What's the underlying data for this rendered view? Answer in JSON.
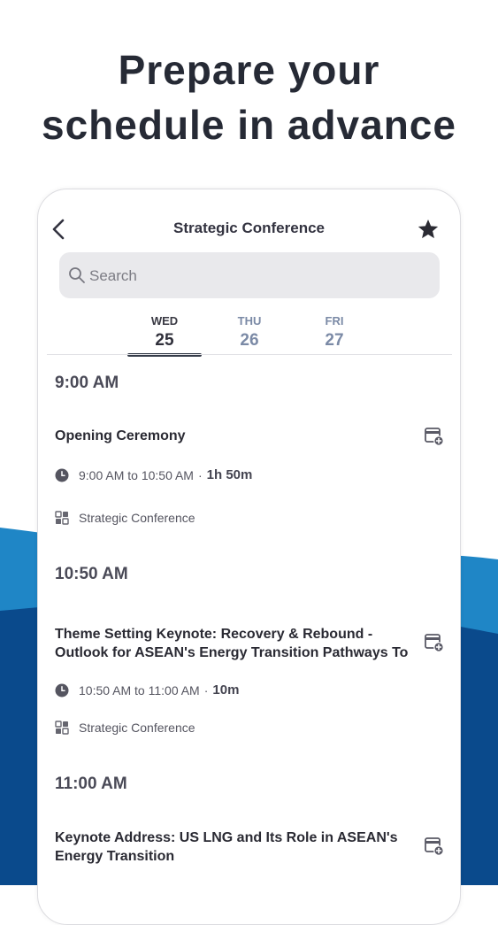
{
  "headline": {
    "line1": "Prepare your",
    "line2": "schedule in advance"
  },
  "colors": {
    "wave_light": "#1f86c6",
    "wave_dark": "#0a4a8c",
    "accent": "#333a47",
    "muted_day": "#7b8aa6"
  },
  "app": {
    "title": "Strategic Conference",
    "back_icon": "chevron-left-icon",
    "favorite_icon": "star-icon",
    "search": {
      "placeholder": "Search",
      "icon": "search-icon"
    },
    "days": [
      {
        "dow": "WED",
        "num": "25",
        "active": true
      },
      {
        "dow": "THU",
        "num": "26",
        "active": false
      },
      {
        "dow": "FRI",
        "num": "27",
        "active": false
      }
    ],
    "groups": [
      {
        "time": "9:00 AM",
        "sessions": [
          {
            "title_lines": [
              "Opening Ceremony"
            ],
            "time_range": "9:00 AM to 10:50 AM",
            "separator": "·",
            "duration": "1h 50m",
            "track": "Strategic Conference"
          }
        ]
      },
      {
        "time": "10:50 AM",
        "sessions": [
          {
            "title_lines": [
              "Theme Setting Keynote: Recovery & Rebound -",
              "Outlook for ASEAN's Energy Transition Pathways To..."
            ],
            "time_range": "10:50 AM to 11:00 AM",
            "separator": "·",
            "duration": "10m",
            "track": "Strategic Conference"
          }
        ]
      },
      {
        "time": "11:00 AM",
        "sessions": [
          {
            "title_lines": [
              "Keynote Address: US LNG and Its Role in ASEAN's",
              "Energy Transition"
            ]
          }
        ]
      }
    ]
  }
}
